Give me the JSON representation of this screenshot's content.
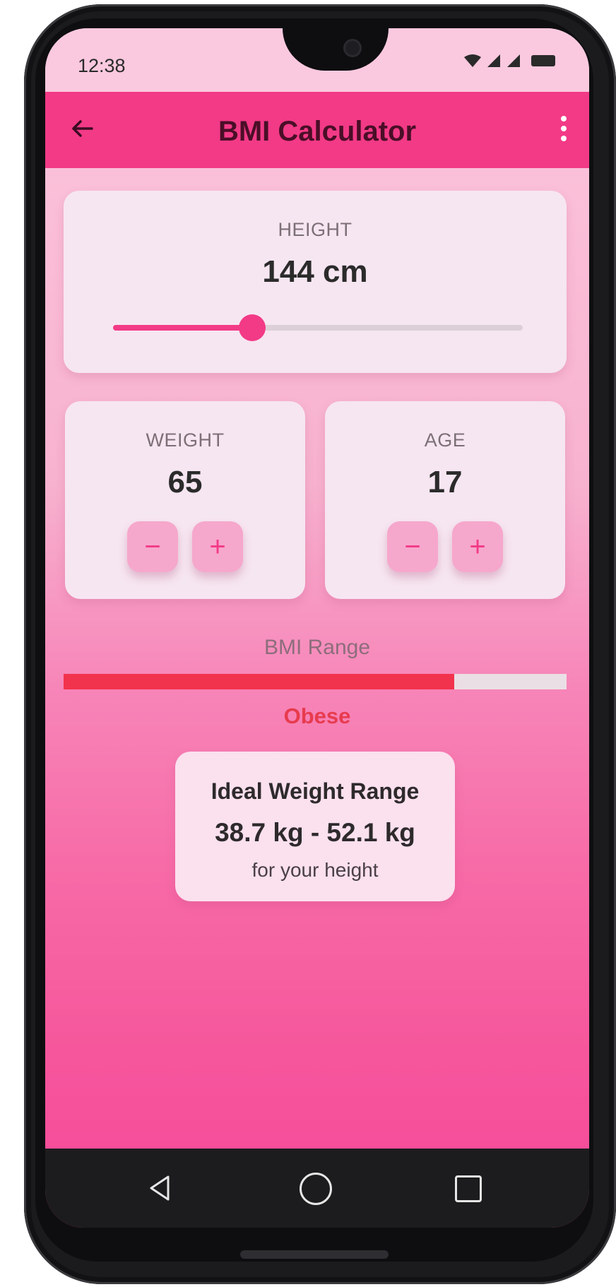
{
  "status_bar": {
    "time": "12:38"
  },
  "app_bar": {
    "title": "BMI Calculator"
  },
  "height": {
    "label": "HEIGHT",
    "value": "144 cm",
    "slider_fraction": 0.34
  },
  "weight": {
    "label": "WEIGHT",
    "value": "65",
    "minus": "−",
    "plus": "+"
  },
  "age": {
    "label": "AGE",
    "value": "17",
    "minus": "−",
    "plus": "+"
  },
  "bmi": {
    "range_label": "BMI Range",
    "bar_fraction": 0.776,
    "category": "Obese"
  },
  "ideal_weight": {
    "title": "Ideal Weight Range",
    "range": "38.7 kg - 52.1 kg",
    "note": "for your height"
  },
  "colors": {
    "accent": "#f23a87",
    "bmi_bar": "#f2334d",
    "category_text": "#e73b4e"
  },
  "icons": [
    "back-arrow-icon",
    "more-vert-icon",
    "nav-back-icon",
    "nav-home-icon",
    "nav-recents-icon",
    "wifi-icon",
    "signal-icon",
    "battery-icon"
  ]
}
